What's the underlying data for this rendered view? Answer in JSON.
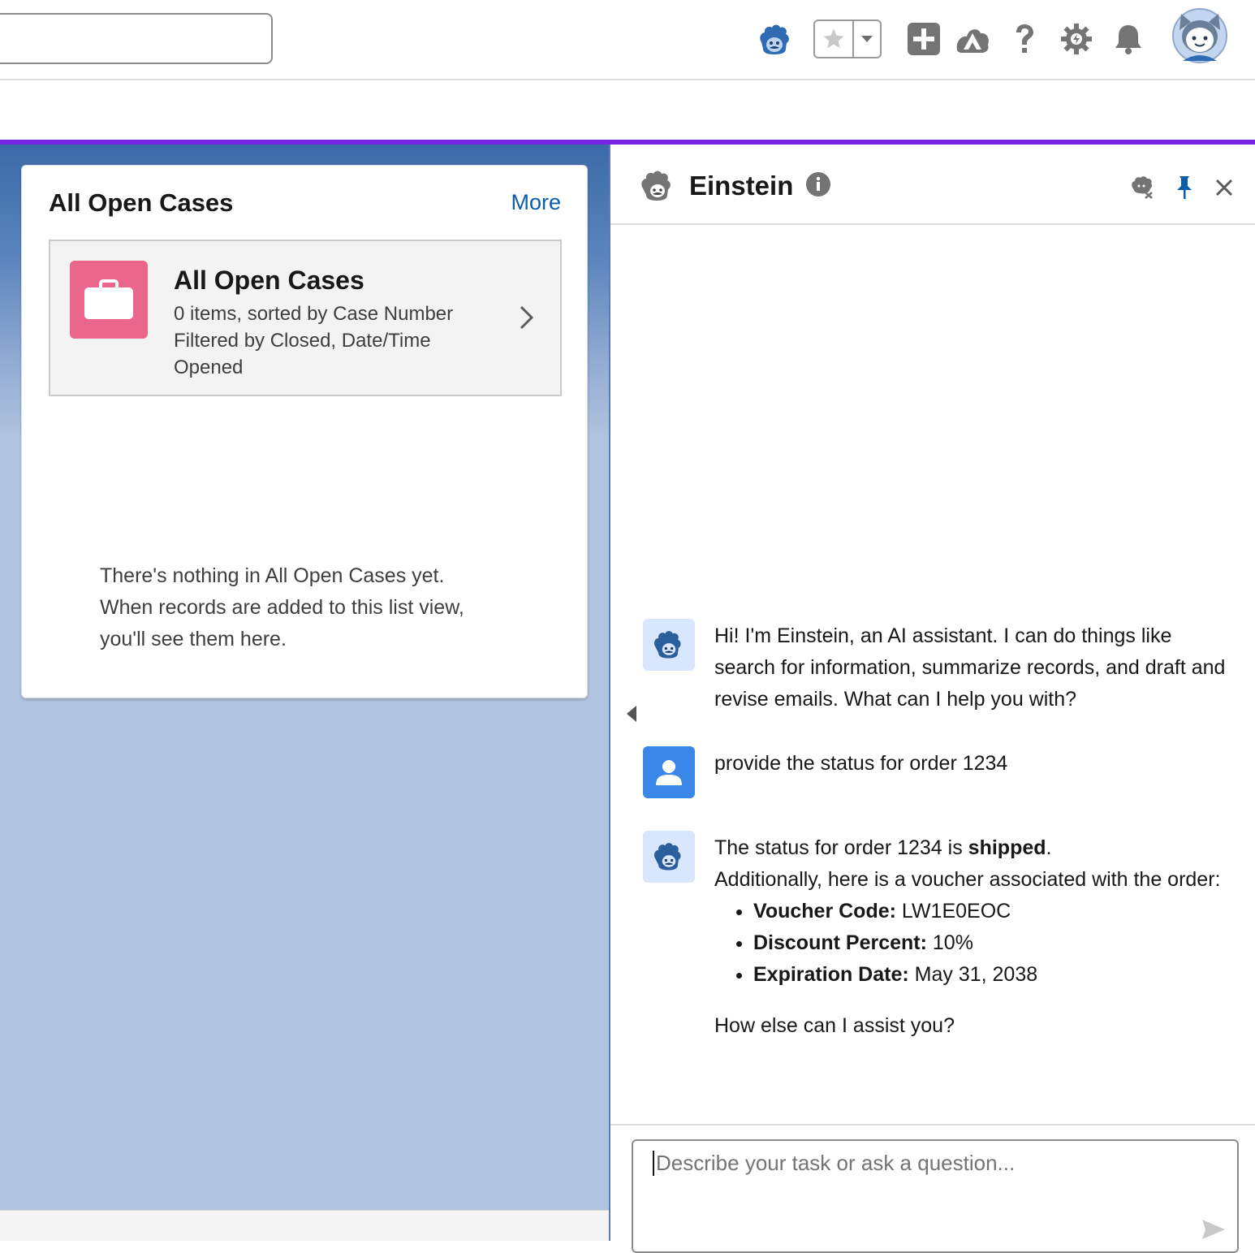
{
  "header": {
    "search": {
      "placeholder": ""
    },
    "icons": [
      "einstein-icon",
      "favorite-star-icon",
      "favorites-dropdown-icon",
      "global-actions-icon",
      "trailhead-icon",
      "help-icon",
      "setup-gear-icon",
      "notifications-bell-icon",
      "user-avatar"
    ]
  },
  "colors": {
    "accent": "#7526e3",
    "case_icon": "#ea668d",
    "link": "#0b5cab",
    "user_avatar": "#3a87e8",
    "bot_avatar": "#d8e6fe"
  },
  "list_card": {
    "title": "All Open Cases",
    "more": "More",
    "tile": {
      "title": "All Open Cases",
      "line1": "0 items, sorted by Case Number",
      "line2": "Filtered by Closed, Date/Time",
      "line3": "Opened"
    },
    "empty": {
      "line1": "There's nothing in All Open Cases yet.",
      "line2": "When records are added to this list view,",
      "line3": "you'll see them here."
    }
  },
  "einstein": {
    "title": "Einstein",
    "messages": {
      "greeting": "Hi! I'm Einstein, an AI assistant. I can do things like search for information, summarize records, and draft and revise emails. What can I help you with?",
      "user_query": "provide the status for order 1234",
      "reply": {
        "intro_before": "The status for order 1234 is ",
        "status": "shipped",
        "intro_after": ".",
        "line2": "Additionally, here is a voucher associated with the order:",
        "items": [
          {
            "label": "Voucher Code:",
            "value": " LW1E0EOC"
          },
          {
            "label": "Discount Percent:",
            "value": " 10%"
          },
          {
            "label": "Expiration Date:",
            "value": " May 31, 2038"
          }
        ],
        "closing": "How else can I assist you?"
      }
    },
    "composer": {
      "placeholder": "Describe your task or ask a question..."
    }
  }
}
